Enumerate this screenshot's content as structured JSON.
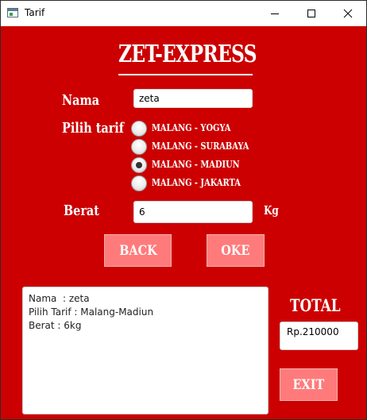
{
  "window": {
    "title": "Tarif",
    "minimize_icon": "minimize-icon",
    "maximize_icon": "maximize-icon",
    "close_icon": "close-icon"
  },
  "header": {
    "title": "ZET-EXPRESS"
  },
  "form": {
    "name_label": "Nama",
    "name_value": "zeta",
    "tariff_label": "Pilih tarif",
    "tariff_options": [
      {
        "label": "MALANG - YOGYA",
        "selected": false
      },
      {
        "label": "MALANG - SURABAYA",
        "selected": false
      },
      {
        "label": "MALANG - MADIUN",
        "selected": true
      },
      {
        "label": "MALANG - JAKARTA",
        "selected": false
      }
    ],
    "weight_label": "Berat",
    "weight_value": "6",
    "weight_unit": "Kg"
  },
  "buttons": {
    "back": "BACK",
    "ok": "OKE",
    "exit": "EXIT"
  },
  "output": {
    "lines": [
      "Nama  : zeta",
      "Pilih Tarif : Malang-Madiun",
      "Berat : 6kg"
    ]
  },
  "total": {
    "label": "TOTAL",
    "value": "Rp.210000"
  },
  "colors": {
    "background": "#cc0000",
    "button": "#ff7b7b",
    "text": "#ffffff"
  }
}
